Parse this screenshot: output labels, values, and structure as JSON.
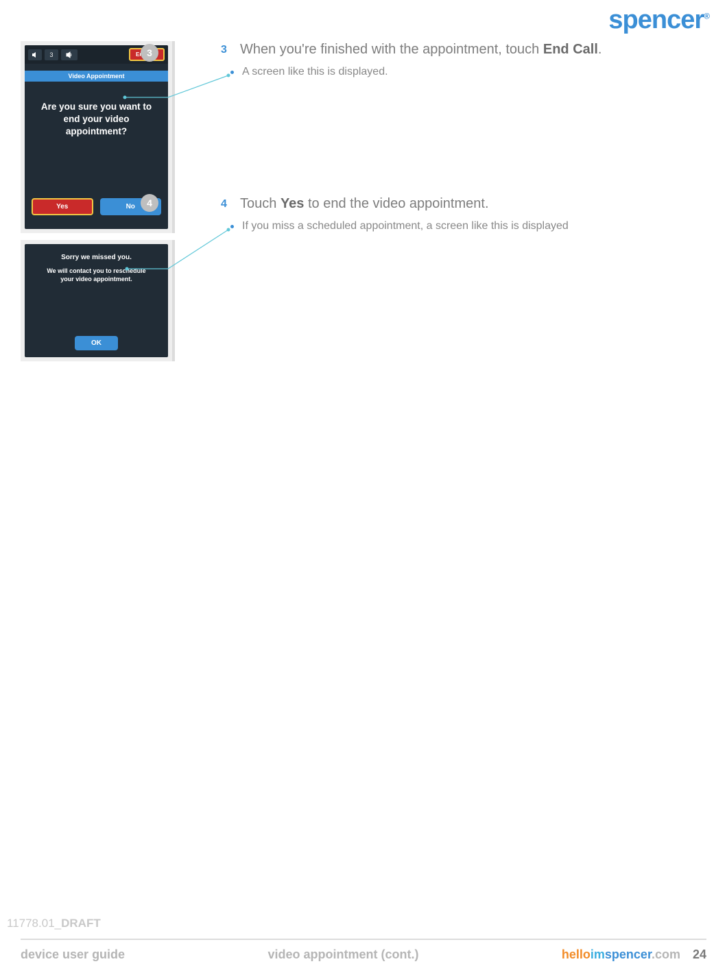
{
  "brand": "spencer",
  "brand_mark": "®",
  "badges": {
    "b3": "3",
    "b4": "4"
  },
  "screen1": {
    "end_call": "End Call",
    "count": "3",
    "blue_band": "Video Appointment",
    "question": "Are you sure you want to end your video appointment?",
    "yes": "Yes",
    "no": "No"
  },
  "screen2": {
    "title": "Sorry we missed you.",
    "body": "We will contact you to reschedule your video appointment.",
    "ok": "OK"
  },
  "steps": {
    "s3": {
      "n": "3",
      "pre": "When you're finished with the appointment, touch ",
      "bold": "End Call",
      "post": "."
    },
    "sub3": "A screen like this is displayed.",
    "s4": {
      "n": "4",
      "pre": "Touch ",
      "bold": "Yes",
      "post": " to end the video appointment."
    },
    "sub4": "If you miss a scheduled appointment, a screen like this is displayed"
  },
  "footer": {
    "draft_pre": "11778.01_",
    "draft_post": "DRAFT",
    "left": "device user guide",
    "center": "video appointment (cont.)",
    "url": {
      "hello": "hello",
      "im": "im",
      "sp": "spencer",
      "dot": ".com"
    },
    "page": "24"
  }
}
